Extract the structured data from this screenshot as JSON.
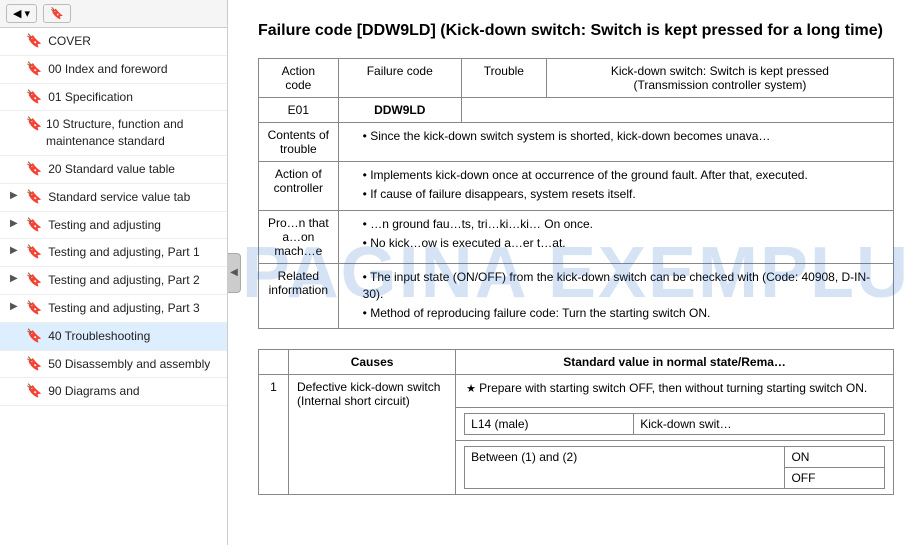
{
  "sidebar": {
    "toolbar": {
      "back_label": "◀",
      "bookmark_label": "🔖"
    },
    "items": [
      {
        "id": "cover",
        "label": "COVER",
        "arrow": "",
        "active": false
      },
      {
        "id": "00-index",
        "label": "00 Index and foreword",
        "arrow": "",
        "active": false
      },
      {
        "id": "01-spec",
        "label": "01 Specification",
        "arrow": "",
        "active": false
      },
      {
        "id": "10-structure",
        "label": "10 Structure, function and maintenance standard",
        "arrow": "",
        "active": false
      },
      {
        "id": "20-standard",
        "label": "20 Standard value table",
        "arrow": "",
        "active": false
      },
      {
        "id": "standard-service",
        "label": "Standard service value tab",
        "arrow": "▶",
        "active": false
      },
      {
        "id": "testing-adj",
        "label": "Testing and adjusting",
        "arrow": "▶",
        "active": false
      },
      {
        "id": "testing-adj-1",
        "label": "Testing and adjusting, Part 1",
        "arrow": "▶",
        "active": false
      },
      {
        "id": "testing-adj-2",
        "label": "Testing and adjusting, Part 2",
        "arrow": "▶",
        "active": false
      },
      {
        "id": "testing-adj-3",
        "label": "Testing and adjusting, Part 3",
        "arrow": "▶",
        "active": false
      },
      {
        "id": "40-trouble",
        "label": "40 Troubleshooting",
        "arrow": "",
        "active": true
      },
      {
        "id": "50-disassembly",
        "label": "50 Disassembly and assembly",
        "arrow": "",
        "active": false
      },
      {
        "id": "90-diagrams",
        "label": "90 Diagrams and",
        "arrow": "",
        "active": false
      }
    ]
  },
  "main": {
    "title": "Failure code [DDW9LD] (Kick-down switch: Switch is kept pressed for a long time)",
    "title_short": "Failure code [DDW9LD] (Kick-down switch: Switch is ke… long time)",
    "watermark": "PAGINA EXEMPLU",
    "info_table": {
      "headers": [
        "Action code",
        "Failure code",
        "Trouble"
      ],
      "action_code": "E01",
      "failure_code": "DDW9LD",
      "trouble": "Kick-down switch: Switch is kept pressed (Transmission controller system)",
      "rows": [
        {
          "label": "Contents of trouble",
          "content": "Since the kick-down switch system is shorted, kick-down becomes unava…"
        },
        {
          "label": "Action of controller",
          "bullets": [
            "Implements kick-down once at occurrence of the ground fault. After that, executed.",
            "If cause of failure disappears, system resets itself."
          ]
        },
        {
          "label": "Problem that a…on machine",
          "bullets": [
            "…n ground fau…ts, tri…ki…ki… On once.",
            "No kick…ow is executed a…er t…at."
          ]
        },
        {
          "label": "Related information",
          "bullets": [
            "The input state (ON/OFF) from the kick-down switch can be checked with (Code: 40908, D-IN-30).",
            "Method of reproducing failure code: Turn the starting switch ON."
          ]
        }
      ]
    },
    "causes_table": {
      "col1": "Causes",
      "col2": "Standard value in normal state/Rema…",
      "rows": [
        {
          "num": "1",
          "cause": "Defective kick-down switch (Internal short circuit)",
          "standard_note": "★ Prepare with starting switch OFF, then without turning starting switch ON.",
          "sub_rows": [
            {
              "connector": "L14 (male)",
              "label": "Kick-down swit…"
            },
            {
              "connector": "Between (1) and (2)",
              "val1": "ON",
              "val2": "OFF"
            }
          ]
        }
      ]
    }
  }
}
